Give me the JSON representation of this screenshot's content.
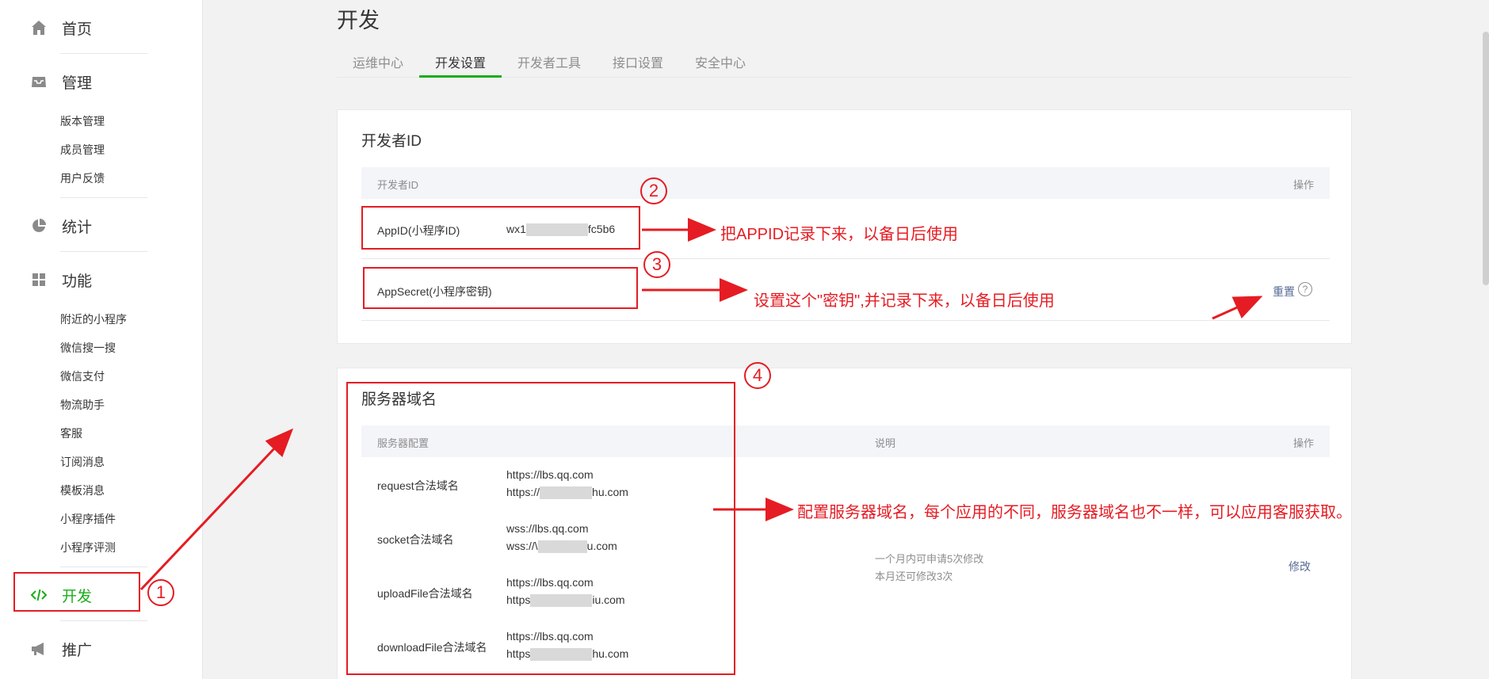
{
  "sidebar": {
    "home": "首页",
    "manage": "管理",
    "manage_sub": [
      "版本管理",
      "成员管理",
      "用户反馈"
    ],
    "stats": "统计",
    "features": "功能",
    "features_sub": [
      "附近的小程序",
      "微信搜一搜",
      "微信支付",
      "物流助手",
      "客服",
      "订阅消息",
      "模板消息",
      "小程序插件",
      "小程序评测"
    ],
    "develop": "开发",
    "promote": "推广"
  },
  "page": {
    "title": "开发",
    "tabs": [
      "运维中心",
      "开发设置",
      "开发者工具",
      "接口设置",
      "安全中心"
    ],
    "active_tab": "开发设置"
  },
  "dev_id": {
    "title": "开发者ID",
    "col_id": "开发者ID",
    "col_action": "操作",
    "appid_label": "AppID(小程序ID)",
    "appid_prefix": "wx1",
    "appid_suffix": "fc5b6",
    "secret_label": "AppSecret(小程序密钥)",
    "reset": "重置",
    "help_icon": "?"
  },
  "server": {
    "title": "服务器域名",
    "col_config": "服务器配置",
    "col_desc": "说明",
    "col_action": "操作",
    "rows": [
      {
        "label": "request合法域名",
        "line1": "https://lbs.qq.com",
        "line2_prefix": "https://",
        "line2_suffix": "hu.com"
      },
      {
        "label": "socket合法域名",
        "line1": "wss://lbs.qq.com",
        "line2_prefix": "wss://\\",
        "line2_suffix": "u.com"
      },
      {
        "label": "uploadFile合法域名",
        "line1": "https://lbs.qq.com",
        "line2_prefix": "https",
        "line2_suffix": "iu.com"
      },
      {
        "label": "downloadFile合法域名",
        "line1": "https://lbs.qq.com",
        "line2_prefix": "https",
        "line2_suffix": "hu.com"
      }
    ],
    "desc1": "一个月内可申请5次修改",
    "desc2": "本月还可修改3次",
    "modify": "修改"
  },
  "annotations": {
    "n1": "1",
    "n2": "2",
    "n3": "3",
    "n4": "4",
    "note2": "把APPID记录下来，以备日后使用",
    "note3": "设置这个\"密钥\",并记录下来，以备日后使用",
    "note4": "配置服务器域名，每个应用的不同，服务器域名也不一样，可以应用客服获取。"
  },
  "colors": {
    "accent": "#1aad19",
    "link": "#576b95",
    "annotation": "#e51c23"
  }
}
